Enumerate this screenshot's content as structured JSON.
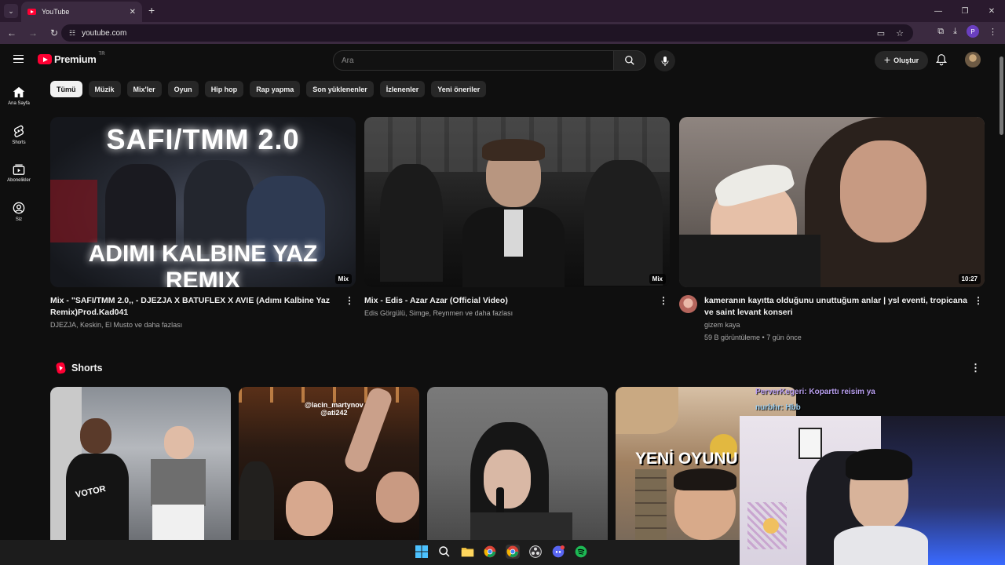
{
  "browser": {
    "tab_title": "YouTube",
    "url": "youtube.com",
    "profile_initial": "P"
  },
  "header": {
    "logo_text": "Premium",
    "country_code": "TR",
    "search_placeholder": "Ara",
    "create_label": "Oluştur"
  },
  "sidebar": {
    "items": [
      {
        "label": "Ana Sayfa",
        "icon": "home-icon"
      },
      {
        "label": "Shorts",
        "icon": "shorts-icon"
      },
      {
        "label": "Abonelikler",
        "icon": "subscriptions-icon"
      },
      {
        "label": "Siz",
        "icon": "you-icon"
      }
    ]
  },
  "chips": [
    "Tümü",
    "Müzik",
    "Mix'ler",
    "Oyun",
    "Hip hop",
    "Rap yapma",
    "Son yüklenenler",
    "İzlenenler",
    "Yeni öneriler"
  ],
  "videos": [
    {
      "title": "Mix - \"SAFI/TMM 2.0,, - DJEZJA X BATUFLEX X AVIE (Adımı Kalbine Yaz Remix)Prod.Kad041",
      "sub": "DJEZJA, Keskin, El Musto ve daha fazlası",
      "badge": "Mix",
      "thumb_line1": "SAFI/TMM 2.0",
      "thumb_line2": "ADIMI KALBINE YAZ REMIX"
    },
    {
      "title": "Mix - Edis - Azar Azar (Official Video)",
      "sub": "Edis Görgülü, Simge, Reynmen ve daha fazlası",
      "badge": "Mix"
    },
    {
      "title": "kameranın kayıtta olduğunu unuttuğum anlar | ysl eventi, tropicana ve saint levant konseri",
      "channel": "gizem kaya",
      "stats": "59 B görüntüleme • 7 gün önce",
      "badge": "10:27"
    }
  ],
  "shorts": {
    "title": "Shorts",
    "items": [
      {
        "overlay": "VOTOR"
      },
      {
        "overlay": "@lacin_martynov\n@ati242"
      },
      {
        "overlay": ""
      },
      {
        "overlay": "YENİ OYUNU",
        "chat1": "PerverKegeri: Koparttı reisim ya",
        "chat2": "nurbhr: Hbb"
      }
    ]
  },
  "taskbar": {
    "apps": [
      "windows-start-icon",
      "search-icon",
      "file-explorer-icon",
      "chrome-icon",
      "chrome-profile-icon",
      "obs-icon",
      "discord-icon",
      "spotify-icon"
    ]
  }
}
